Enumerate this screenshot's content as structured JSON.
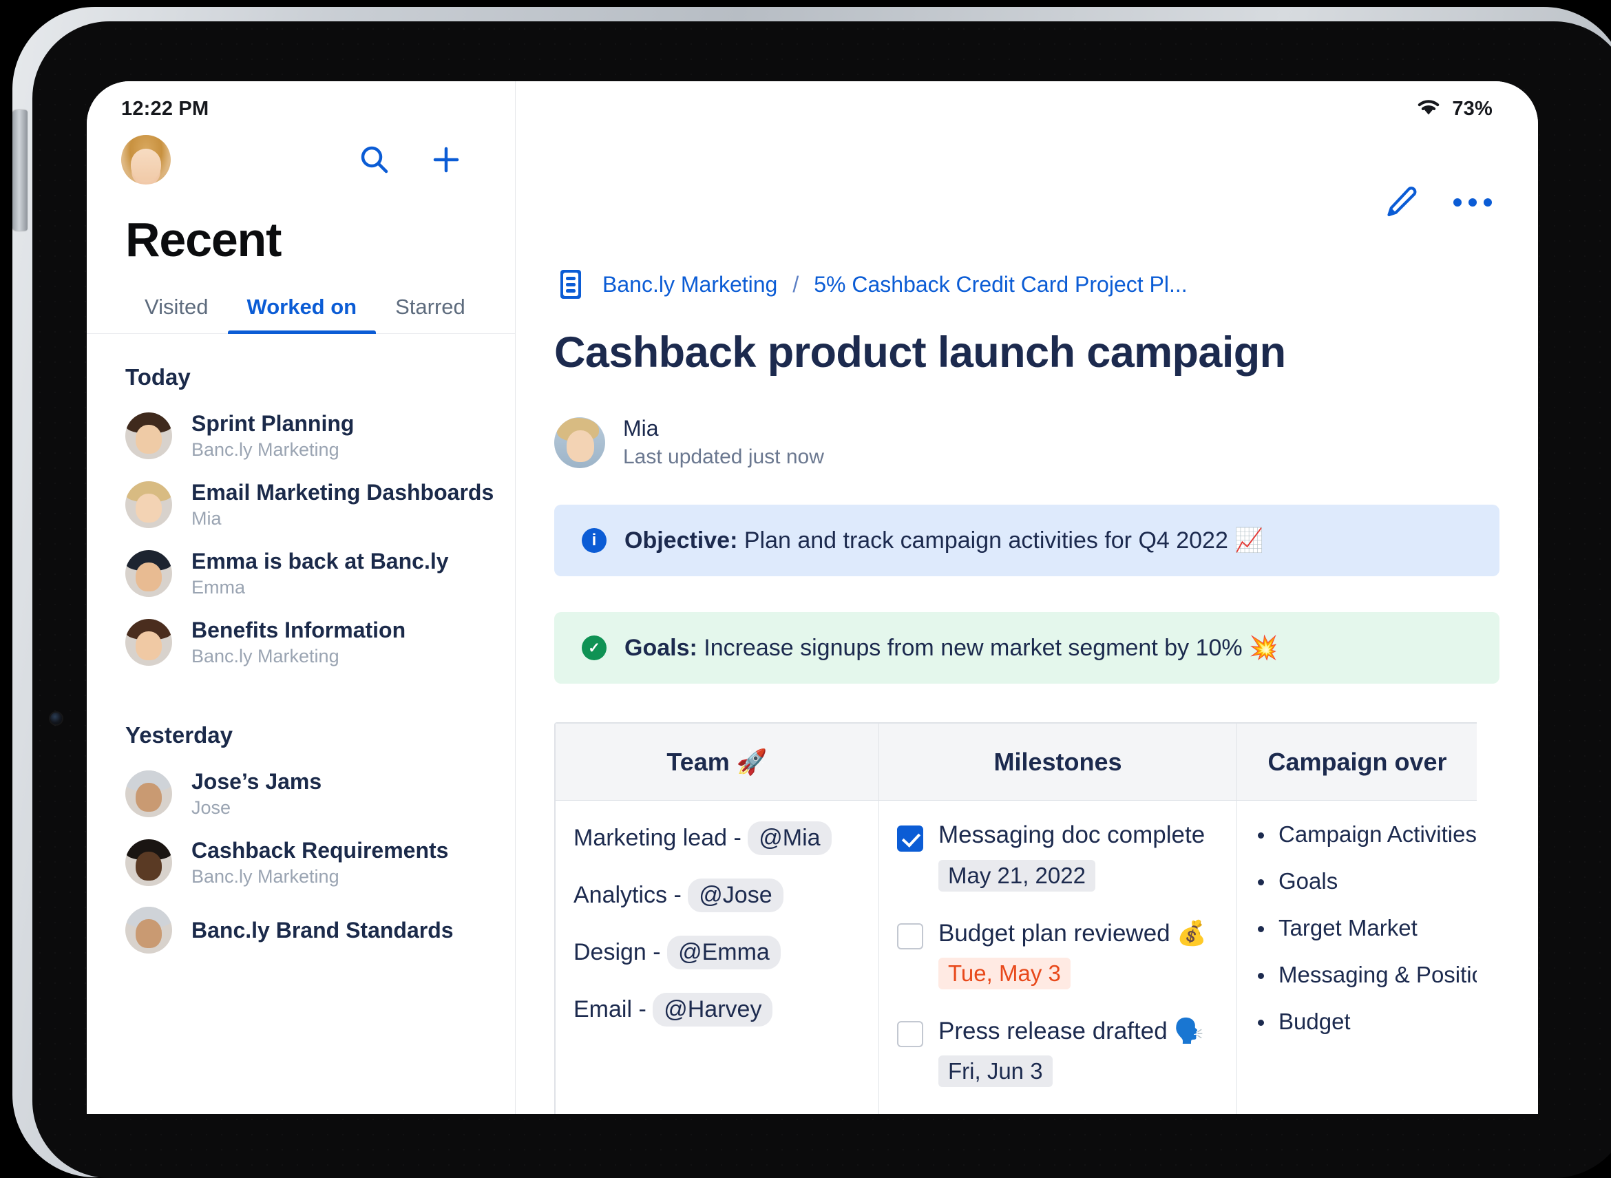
{
  "status_bar": {
    "time": "12:22 PM",
    "wifi_icon": "wifi-icon",
    "battery_percent": "73%"
  },
  "sidebar": {
    "avatar_name": "user-avatar",
    "search_icon": "search-icon",
    "add_icon": "plus-icon",
    "title": "Recent",
    "tabs": [
      {
        "label": "Visited",
        "active": false
      },
      {
        "label": "Worked on",
        "active": true
      },
      {
        "label": "Starred",
        "active": false
      }
    ],
    "groups": [
      {
        "label": "Today",
        "items": [
          {
            "title": "Sprint Planning",
            "sub": "Banc.ly Marketing",
            "hair": "#3f2a1d",
            "skin": "#efcba6"
          },
          {
            "title": "Email Marketing Dashboards",
            "sub": "Mia",
            "hair": "#d8bb82",
            "skin": "#f3d3b4"
          },
          {
            "title": "Emma is back at Banc.ly",
            "sub": "Emma",
            "hair": "#1d2430",
            "skin": "#e8bb92"
          },
          {
            "title": "Benefits Information",
            "sub": "Banc.ly Marketing",
            "hair": "#4a2d1e",
            "skin": "#f0c9a4"
          }
        ]
      },
      {
        "label": "Yesterday",
        "items": [
          {
            "title": "Jose’s Jams",
            "sub": "Jose",
            "hair": "#cfd3d8",
            "skin": "#c99a72"
          },
          {
            "title": "Cashback Requirements",
            "sub": "Banc.ly Marketing",
            "hair": "#1a1512",
            "skin": "#5a3a24"
          },
          {
            "title": "Banc.ly Brand Standards",
            "sub": "",
            "hair": "#cfd3d8",
            "skin": "#c99a72"
          }
        ]
      }
    ]
  },
  "main": {
    "toolbar": {
      "edit_icon": "pencil-icon",
      "more_icon": "more-options-icon"
    },
    "breadcrumb": {
      "doc_icon": "document-stack-icon",
      "items": [
        "Banc.ly Marketing",
        "5% Cashback Credit Card Project Pl..."
      ],
      "separator": "/"
    },
    "doc_title": "Cashback product launch campaign",
    "author": {
      "name": "Mia",
      "meta": "Last updated just now"
    },
    "callouts": [
      {
        "icon": "info-icon",
        "icon_glyph": "i",
        "variant": "info",
        "bold": "Objective:",
        "text": " Plan and track campaign activities for Q4 2022 📈",
        "bg_color": "#deeafc",
        "accent_color": "#0b5cd5"
      },
      {
        "icon": "check-circle-icon",
        "icon_glyph": "✓",
        "variant": "success",
        "bold": "Goals:",
        "text": " Increase signups from new market segment by 10% 💥",
        "bg_color": "#e4f7ec",
        "accent_color": "#0f9254"
      }
    ],
    "table": {
      "headers": [
        "Team 🚀",
        "Milestones",
        "Campaign over"
      ],
      "team_rows": [
        {
          "role": "Marketing lead - ",
          "mention": "@Mia"
        },
        {
          "role": "Analytics - ",
          "mention": "@Jose"
        },
        {
          "role": "Design - ",
          "mention": "@Emma"
        },
        {
          "role": "Email - ",
          "mention": "@Harvey"
        }
      ],
      "milestones": [
        {
          "label": "Messaging doc complete",
          "checked": true,
          "date": "May 21, 2022",
          "date_style": "gray"
        },
        {
          "label": "Budget plan reviewed 💰",
          "checked": false,
          "date": "Tue, May 3",
          "date_style": "red"
        },
        {
          "label": "Press release drafted 🗣️",
          "checked": false,
          "date": "Fri, Jun 3",
          "date_style": "gray"
        }
      ],
      "overview": [
        "Campaign Activities",
        "Goals",
        "Target Market",
        "Messaging & Positioni",
        "Budget"
      ]
    }
  }
}
